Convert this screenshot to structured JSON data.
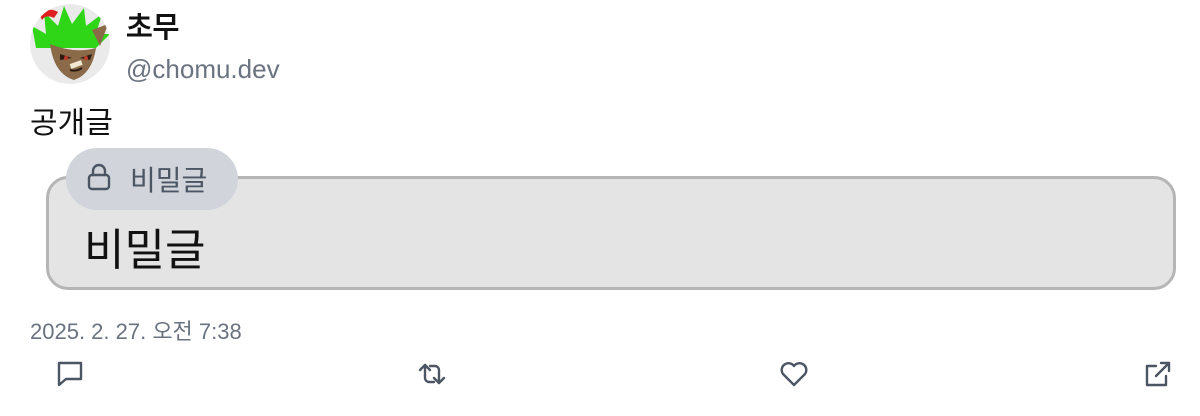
{
  "author": {
    "display_name": "초무",
    "handle": "@chomu.dev",
    "avatar_icon": "avatar-image"
  },
  "post": {
    "text": "공개글",
    "secret": {
      "badge_label": "비밀글",
      "badge_icon": "lock-icon",
      "content": "비밀글"
    },
    "timestamp": "2025. 2. 27. 오전 7:38"
  },
  "actions": [
    {
      "name": "reply",
      "icon": "comment-icon"
    },
    {
      "name": "repost",
      "icon": "repost-icon"
    },
    {
      "name": "like",
      "icon": "heart-icon"
    },
    {
      "name": "share",
      "icon": "external-link-icon"
    }
  ],
  "colors": {
    "muted_text": "#6b7280",
    "secret_box_bg": "#e4e4e4",
    "secret_box_border": "#b5b5b5",
    "badge_bg": "#d1d5db"
  }
}
